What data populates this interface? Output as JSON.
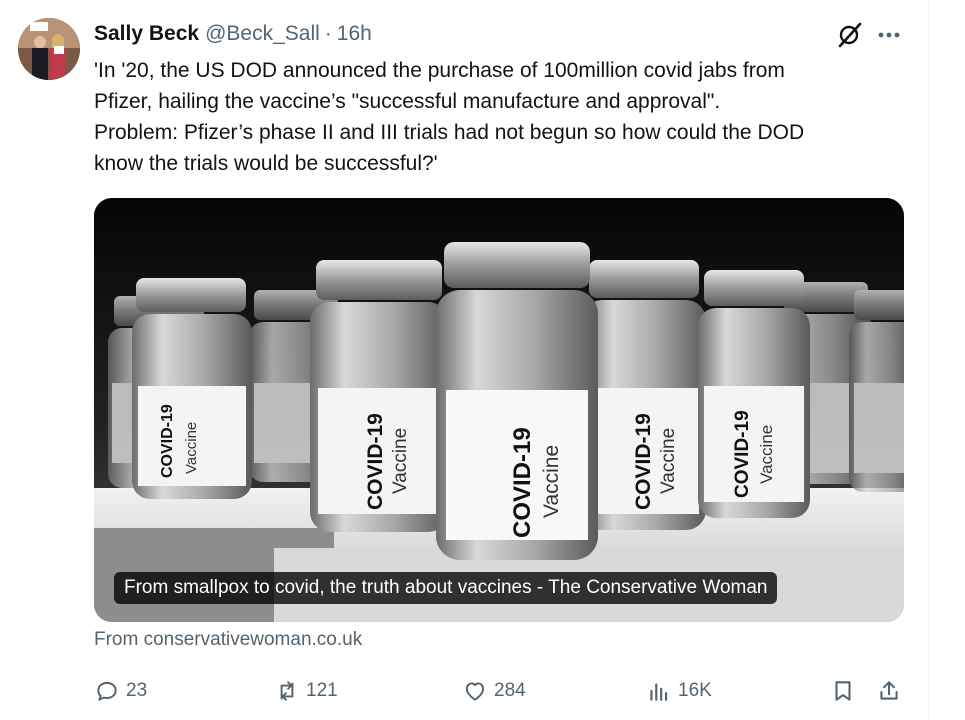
{
  "tweet": {
    "author_name": "Sally Beck",
    "author_handle": "@Beck_Sall",
    "separator": "·",
    "time": "16h",
    "text": "'In '20, the US DOD announced the purchase of 100million covid jabs from\nPfizer, hailing the vaccine’s \"successful manufacture and approval\".\nProblem: Pfizer’s phase II and III trials had not begun so how could the DOD\nknow the trials would be successful?'"
  },
  "card": {
    "caption": "From smallpox to covid, the truth about vaccines - The Conservative Woman",
    "source": "From conservativewoman.co.uk",
    "vial_label_main": "COVID-19",
    "vial_label_sub": "Vaccine"
  },
  "actions": {
    "replies": "23",
    "reposts": "121",
    "likes": "284",
    "views": "16K"
  },
  "icons": {
    "grok": "grok-slash-circle-icon",
    "more": "more-dots-icon",
    "reply": "speech-bubble-icon",
    "repost": "repost-arrows-icon",
    "like": "heart-icon",
    "views": "bar-chart-icon",
    "bookmark": "bookmark-icon",
    "share": "share-upload-icon"
  },
  "colors": {
    "text": "#0f1419",
    "secondary": "#536471"
  }
}
